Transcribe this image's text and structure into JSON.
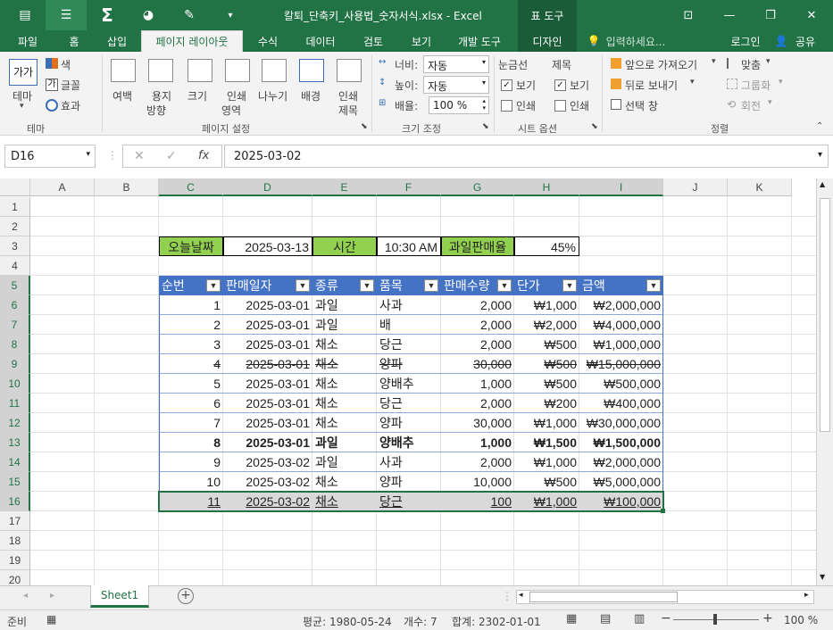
{
  "window": {
    "title": "칼퇴_단축키_사용법_숫자서식.xlsx - Excel",
    "tool_tab": "표 도구",
    "minimize": "—",
    "restore": "❐",
    "close": "✕"
  },
  "tabs": [
    "파일",
    "홈",
    "삽입",
    "페이지 레이아웃",
    "수식",
    "데이터",
    "검토",
    "보기",
    "개발 도구",
    "디자인"
  ],
  "tell_me": "입력하세요...",
  "login": "로그인",
  "share": "공유",
  "ribbon": {
    "theme": {
      "label": "테마",
      "colors": "색",
      "fonts": "글꼴",
      "effects": "효과",
      "group": "테마"
    },
    "page_setup": {
      "margins": "여백",
      "orientation1": "용지",
      "orientation2": "방향",
      "size": "크기",
      "print_area1": "인쇄",
      "print_area2": "영역",
      "breaks": "나누기",
      "background": "배경",
      "print_titles1": "인쇄",
      "print_titles2": "제목",
      "group": "페이지 설정"
    },
    "scale": {
      "width_label": "너비:",
      "width_value": "자동",
      "height_label": "높이:",
      "height_value": "자동",
      "scale_label": "배율:",
      "scale_value": "100 %",
      "group": "크기 조정"
    },
    "sheet_options": {
      "gridlines": "눈금선",
      "headings": "제목",
      "view": "보기",
      "print": "인쇄",
      "group": "시트 옵션"
    },
    "arrange": {
      "bring_forward": "앞으로 가져오기",
      "send_backward": "뒤로 보내기",
      "selection_pane": "선택 창",
      "align": "맞춤",
      "group_btn": "그룹화",
      "rotate": "회전",
      "group": "정렬"
    }
  },
  "formula_bar": {
    "name_box": "D16",
    "formula": "2025-03-02"
  },
  "columns": [
    "A",
    "B",
    "C",
    "D",
    "E",
    "F",
    "G",
    "H",
    "I",
    "J",
    "K"
  ],
  "rows": [
    "1",
    "2",
    "3",
    "4",
    "5",
    "6",
    "7",
    "8",
    "9",
    "10",
    "11",
    "12",
    "13",
    "14",
    "15",
    "16",
    "17",
    "18",
    "19",
    "20"
  ],
  "info": {
    "today_label": "오늘날짜",
    "today_value": "2025-03-13",
    "time_label": "시간",
    "time_value": "10:30 AM",
    "rate_label": "과일판매율",
    "rate_value": "45%"
  },
  "table": {
    "headers": [
      "순번",
      "판매일자",
      "종류",
      "품목",
      "판매수량",
      "단가",
      "금액"
    ],
    "rows": [
      [
        "1",
        "2025-03-01",
        "과일",
        "사과",
        "2,000",
        "₩1,000",
        "₩2,000,000"
      ],
      [
        "2",
        "2025-03-01",
        "과일",
        "배",
        "2,000",
        "₩2,000",
        "₩4,000,000"
      ],
      [
        "3",
        "2025-03-01",
        "채소",
        "당근",
        "2,000",
        "₩500",
        "₩1,000,000"
      ],
      [
        "4",
        "2025-03-01",
        "채소",
        "양파",
        "30,000",
        "₩500",
        "₩15,000,000"
      ],
      [
        "5",
        "2025-03-01",
        "채소",
        "양배추",
        "1,000",
        "₩500",
        "₩500,000"
      ],
      [
        "6",
        "2025-03-01",
        "채소",
        "당근",
        "2,000",
        "₩200",
        "₩400,000"
      ],
      [
        "7",
        "2025-03-01",
        "채소",
        "양파",
        "30,000",
        "₩1,000",
        "₩30,000,000"
      ],
      [
        "8",
        "2025-03-01",
        "과일",
        "양배추",
        "1,000",
        "₩1,500",
        "₩1,500,000"
      ],
      [
        "9",
        "2025-03-02",
        "과일",
        "사과",
        "2,000",
        "₩1,000",
        "₩2,000,000"
      ],
      [
        "10",
        "2025-03-02",
        "채소",
        "양파",
        "10,000",
        "₩500",
        "₩5,000,000"
      ],
      [
        "11",
        "2025-03-02",
        "채소",
        "당근",
        "100",
        "₩1,000",
        "₩100,000"
      ]
    ]
  },
  "sheet_tab": "Sheet1",
  "status": {
    "ready": "준비",
    "average": "평균: 1980-05-24",
    "count": "개수: 7",
    "sum": "합계: 2302-01-01",
    "zoom": "100 %"
  }
}
